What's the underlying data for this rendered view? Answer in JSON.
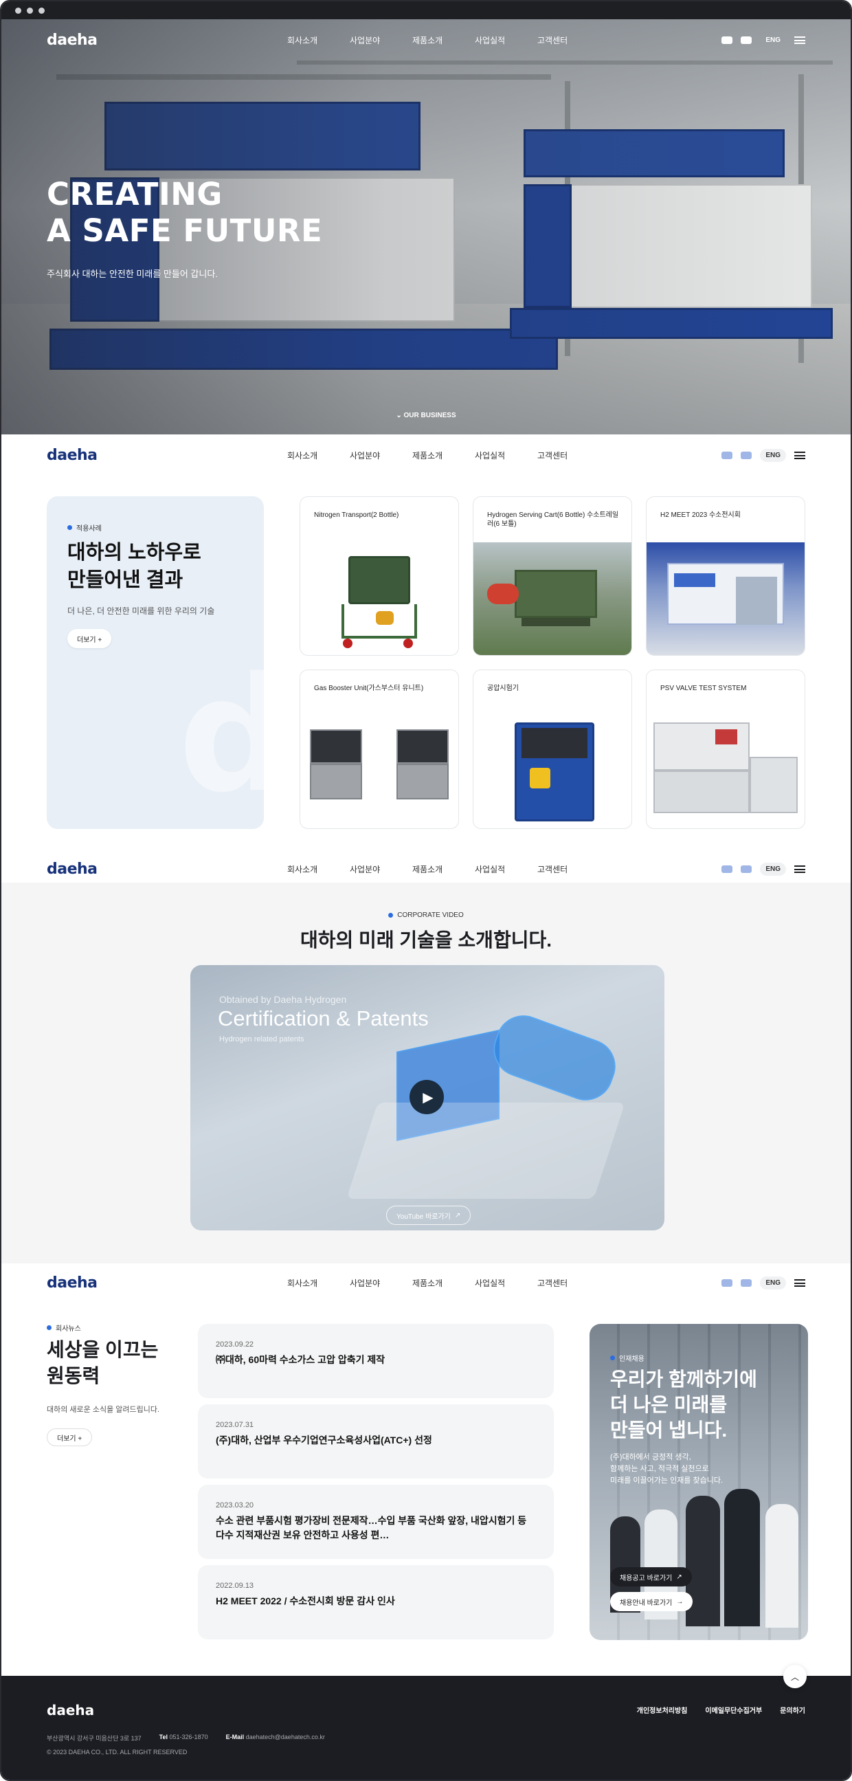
{
  "logo": "daeha",
  "nav": {
    "items": [
      "회사소개",
      "사업분야",
      "제품소개",
      "사업실적",
      "고객센터"
    ],
    "lang": "ENG"
  },
  "hero": {
    "line1": "CREATING",
    "line2": "A SAFE FUTURE",
    "subtitle": "주식회사 대하는 안전한 미래를 만들어 갑니다.",
    "more": "OUR BUSINESS"
  },
  "cases": {
    "tag": "적용사례",
    "title1": "대하의 노하우로",
    "title2": "만들어낸 결과",
    "desc": "더 나은, 더 안전한 미래를 위한 우리의 기술",
    "more": "더보기 +",
    "items": [
      "Nitrogen Transport(2 Bottle)",
      "Hydrogen Serving Cart(6 Bottle) 수소트레일러(6 보틀)",
      "H2 MEET 2023 수소전시회",
      "Gas Booster Unit(가스부스터 유니트)",
      "공압시험기",
      "PSV VALVE TEST SYSTEM"
    ]
  },
  "video": {
    "tag": "CORPORATE VIDEO",
    "title": "대하의 미래 기술을 소개합니다.",
    "overlay_small": "Obtained by Daeha Hydrogen",
    "overlay_big": "Certification & Patents",
    "overlay_sub": "Hydrogen related patents",
    "button": "YouTube 바로가기"
  },
  "news": {
    "tag": "회사뉴스",
    "title1": "세상을 이끄는",
    "title2": "원동력",
    "desc": "대하의 새로운 소식을 알려드립니다.",
    "more": "더보기 +",
    "items": [
      {
        "date": "2023.09.22",
        "title": "㈜대하, 60마력 수소가스 고압 압축기 제작"
      },
      {
        "date": "2023.07.31",
        "title": "(주)대하, 산업부 우수기업연구소육성사업(ATC+) 선정"
      },
      {
        "date": "2023.03.20",
        "title": "수소 관련 부품시험 평가장비 전문제작…수입 부품 국산화 앞장, 내압시험기 등 다수 지적재산권 보유 안전하고 사용성 편…"
      },
      {
        "date": "2022.09.13",
        "title": "H2 MEET 2022 / 수소전시회 방문 감사 인사"
      }
    ]
  },
  "recruit": {
    "tag": "인재채용",
    "title1": "우리가 함께하기에",
    "title2": "더 나은 미래를",
    "title3": "만들어 냅니다.",
    "desc1": "(주)대하에서 긍정적 생각,",
    "desc2": "함께하는 사고, 적극적 실천으로",
    "desc3": "미래를 이끌어가는 인재를 찾습니다.",
    "btn1": "채용공고 바로가기",
    "btn2": "채용안내 바로가기"
  },
  "footer": {
    "links": [
      "개인정보처리방침",
      "이메일무단수집거부",
      "문의하기"
    ],
    "address": "부산광역시 강서구 미음산단 3로 137",
    "tel_label": "Tel",
    "tel": "051-326-1870",
    "email_label": "E-Mail",
    "email": "daehatech@daehatech.co.kr",
    "copyright": "© 2023 DAEHA CO., LTD. ALL RIGHT RESERVED"
  },
  "colors": {
    "brand": "#17327a",
    "accent": "#2b6de0",
    "footer": "#1c1d22"
  }
}
